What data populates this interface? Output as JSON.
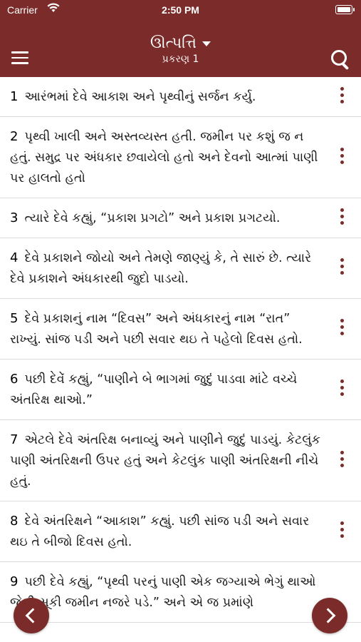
{
  "status_bar": {
    "carrier": "Carrier",
    "time": "2:50 PM"
  },
  "header": {
    "book": "ઊત્પત્તિ",
    "chapter": "પ્રકરણ 1"
  },
  "verses": [
    {
      "num": "1",
      "text": "આરંભમાં દેવે આકાશ અને પૃથ્વીનું સર્જન કર્યુ."
    },
    {
      "num": "2",
      "text": "પૃથ્વી ખાલી અને અસ્તવ્યસ્ત હતી. જમીન પર કશું જ ન હતું. સમુદ્ર પર અંધકાર છવાયેલો હતો અને દેવનો આત્માં પાણી પર હાલતો હતો"
    },
    {
      "num": "3",
      "text": "ત્યારે દેવે કહ્યું, “પ્રકાશ પ્રગટો” અને પ્રકાશ પ્રગટયો."
    },
    {
      "num": "4",
      "text": "દેવે પ્રકાશને જોયો અને તેમણે જાણ્યું કે, તે સારું છે. ત્યારે દેવે પ્રકાશને અંધકારથી જુદો પાડયો."
    },
    {
      "num": "5",
      "text": "દેવે પ્રકાશનું નામ “દિવસ” અને અંધકારનું નામ “રાત” રાખ્યું. સાંજ પડી અને પછી સવાર થઇ તે પહેલો દિવસ હતો."
    },
    {
      "num": "6",
      "text": "પછી દેવેૅ કહ્યું, “પાણીને બે ભાગમાં જુદું પાડવા માંટે વચ્ચે અંતરિક્ષ થાઓ.”"
    },
    {
      "num": "7",
      "text": "એટલે દેવે અંતરિક્ષ બનાવ્યું અને પાણીને જુદું પાડયું. કેટલુંક પાણી અંતરિક્ષની ઉપર હતું અને કેટલુંક પાણી અંતરિક્ષની નીચે હતું."
    },
    {
      "num": "8",
      "text": "દેવે અંતરિક્ષને “આકાશ” કહ્યું. પછી સાંજ પડી અને સવાર થઇ તે બીજો દિવસ હતો."
    },
    {
      "num": "9",
      "text": "પછી દેવે કહ્યું, “પૃથ્વી પરનું પાણી એક જગ્યાએ ભેગું થાઓ જેથી સૂકી જમીન નજરે પડે.” અને એ જ પ્રમાંણે"
    }
  ],
  "colors": {
    "accent": "#7b2c2a"
  },
  "icons": {
    "menu": "hamburger-icon",
    "search": "search-icon",
    "more": "more-vertical-icon",
    "prev": "chevron-left-icon",
    "next": "chevron-right-icon"
  }
}
